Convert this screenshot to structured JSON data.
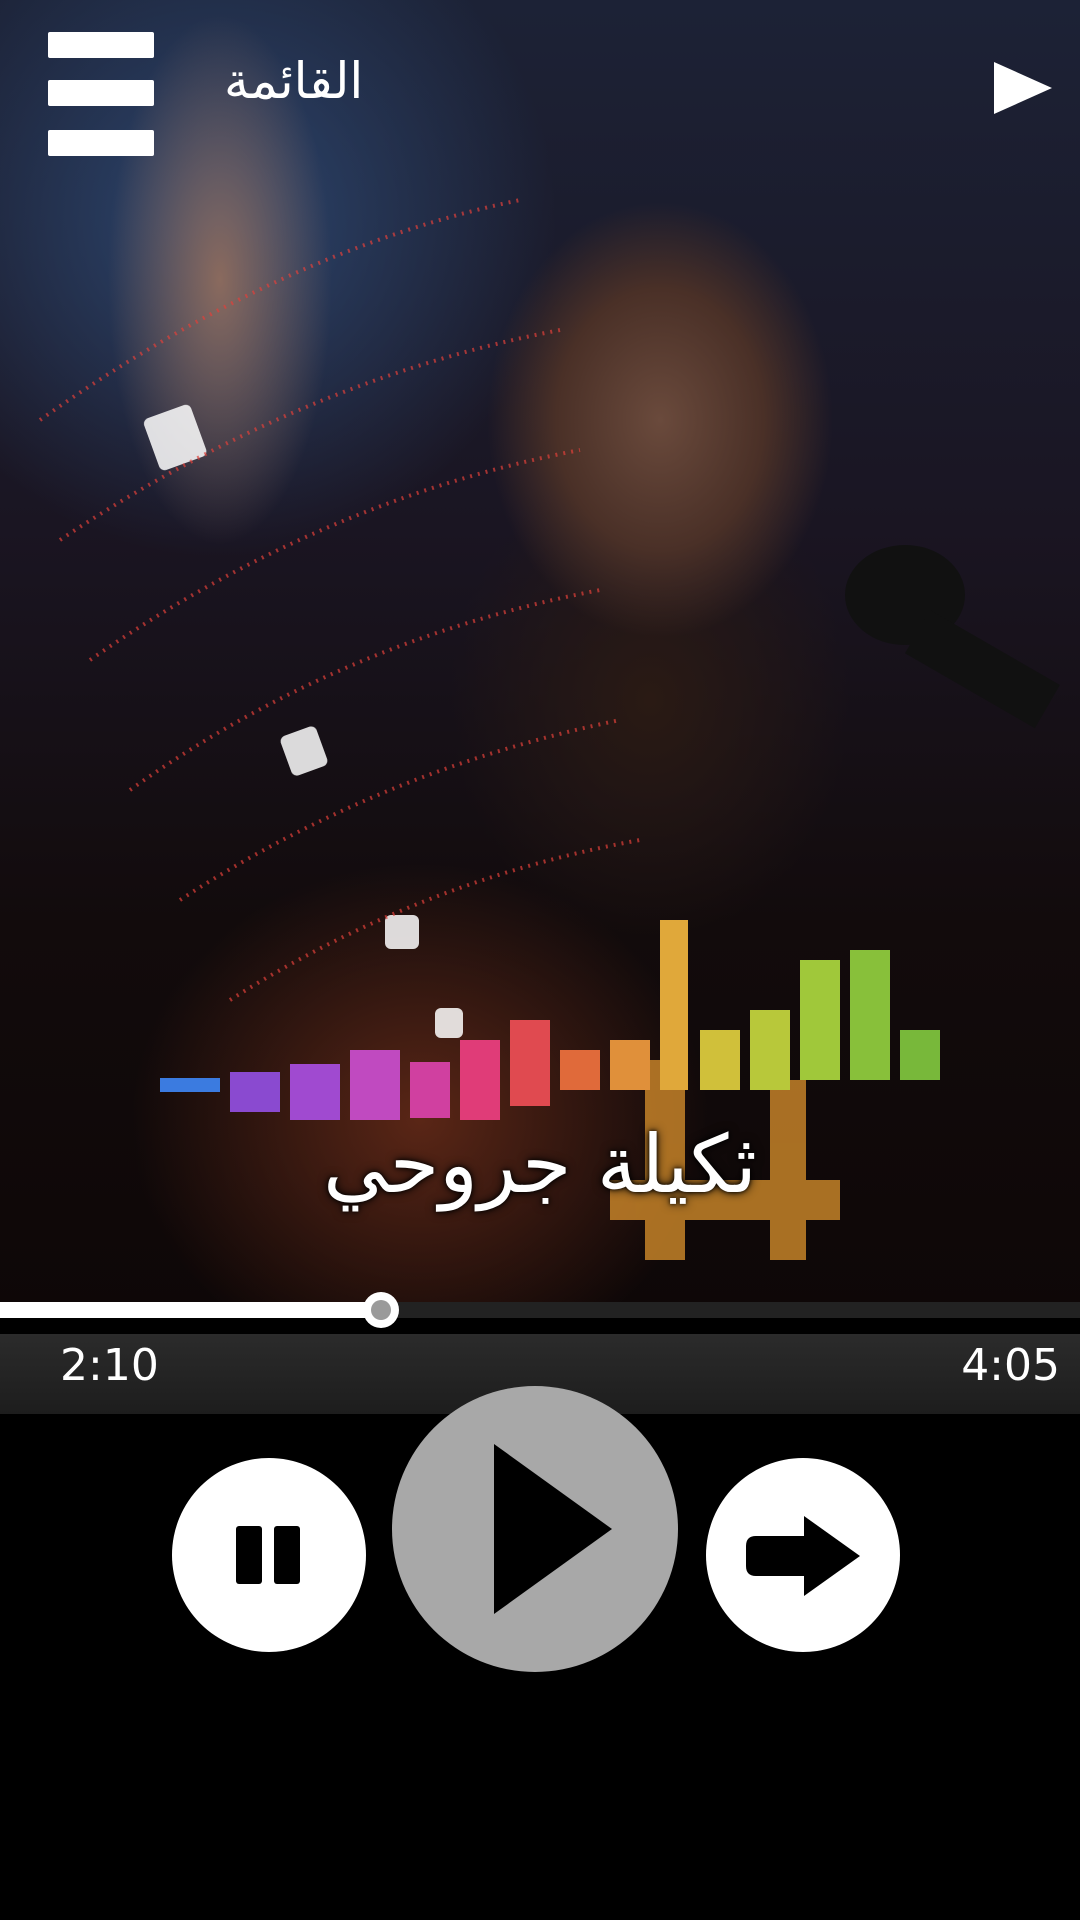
{
  "header": {
    "menu_label": "القائمة"
  },
  "track": {
    "title": "ثكيلة جروحي"
  },
  "player": {
    "elapsed": "2:10",
    "duration": "4:05",
    "progress": 0.353
  },
  "colors": {
    "background": "#000000",
    "seek_fill": "#ffffff",
    "play_button": "#a8a8a8"
  },
  "icons": {
    "menu": "hamburger-icon",
    "header_play": "play-icon",
    "pause": "pause-icon",
    "play": "play-icon",
    "next": "arrow-right-icon"
  }
}
